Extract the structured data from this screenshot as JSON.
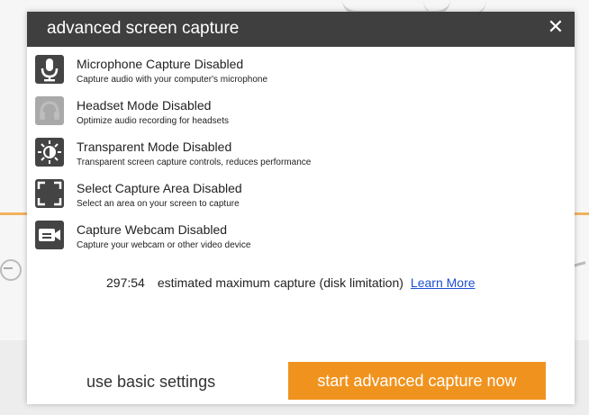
{
  "dialog": {
    "title": "advanced screen capture",
    "close_symbol": "✕"
  },
  "options": [
    {
      "icon": "microphone-icon",
      "title": "Microphone Capture Disabled",
      "desc": "Capture audio with your computer's microphone"
    },
    {
      "icon": "headset-icon",
      "title": "Headset Mode Disabled",
      "desc": "Optimize audio recording for headsets"
    },
    {
      "icon": "transparent-mode-icon",
      "title": "Transparent Mode Disabled",
      "desc": "Transparent screen capture controls, reduces performance"
    },
    {
      "icon": "capture-area-icon",
      "title": "Select Capture Area Disabled",
      "desc": "Select an area on your screen to capture"
    },
    {
      "icon": "webcam-icon",
      "title": "Capture Webcam Disabled",
      "desc": "Capture your webcam or other video device"
    }
  ],
  "estimate": {
    "time": "297:54",
    "text": "estimated maximum capture (disk limitation)",
    "learn_more": "Learn More"
  },
  "footer": {
    "basic_label": "use basic settings",
    "start_label": "start advanced capture now"
  },
  "colors": {
    "title_bar": "#3f3f3f",
    "accent": "#f0931e",
    "link": "#1f4fd1"
  }
}
